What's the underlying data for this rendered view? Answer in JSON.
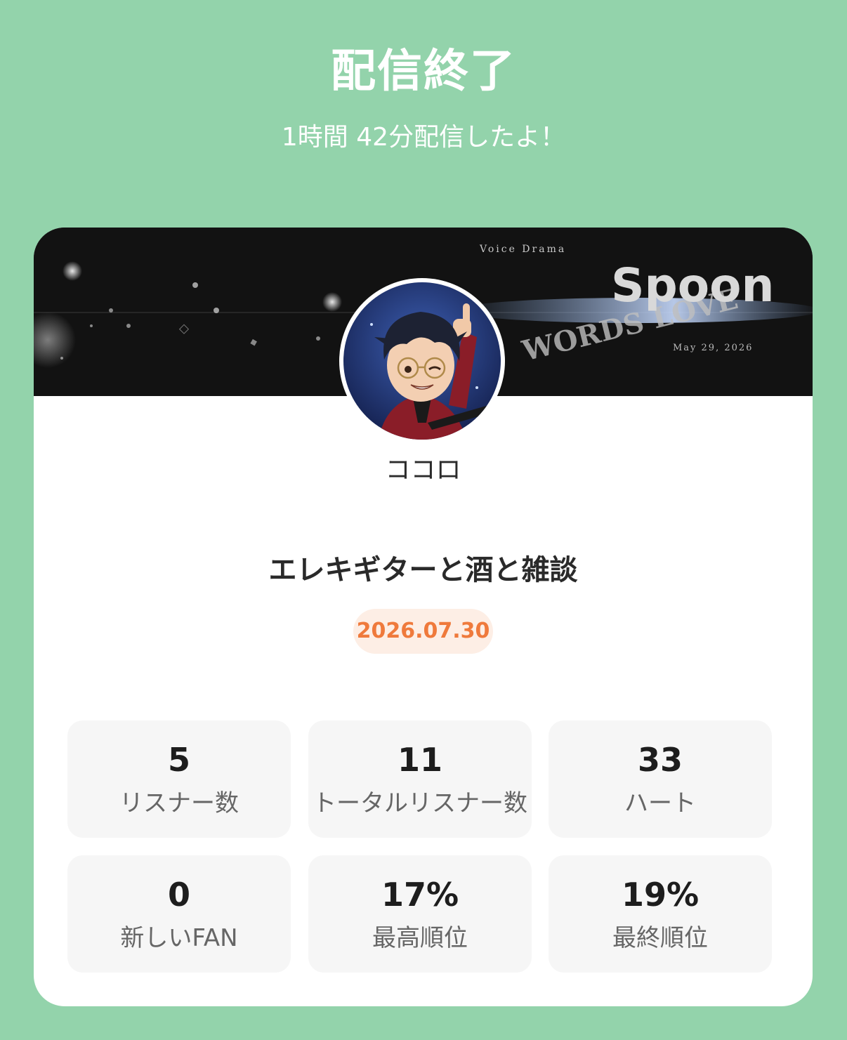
{
  "header": {
    "title": "配信終了",
    "subtitle": "1時間 42分配信したよ！"
  },
  "banner": {
    "small_caption": "Voice Drama",
    "brand": "Spoon",
    "date_text": "May 29, 2026",
    "art_text": "WORDS LOVE"
  },
  "profile": {
    "name": "ココロ"
  },
  "broadcast": {
    "title": "エレキギターと酒と雑談",
    "date": "2026.07.30"
  },
  "stats": [
    {
      "value": "5",
      "label": "リスナー数"
    },
    {
      "value": "11",
      "label": "トータルリスナー数"
    },
    {
      "value": "33",
      "label": "ハート"
    },
    {
      "value": "0",
      "label": "新しいFAN"
    },
    {
      "value": "17%",
      "label": "最高順位"
    },
    {
      "value": "19%",
      "label": "最終順位"
    }
  ],
  "colors": {
    "background": "#93d3ab",
    "card": "#ffffff",
    "accent_date": "#ef7a3c",
    "date_pill": "#fdeee5",
    "stat_bg": "#f6f6f6"
  }
}
